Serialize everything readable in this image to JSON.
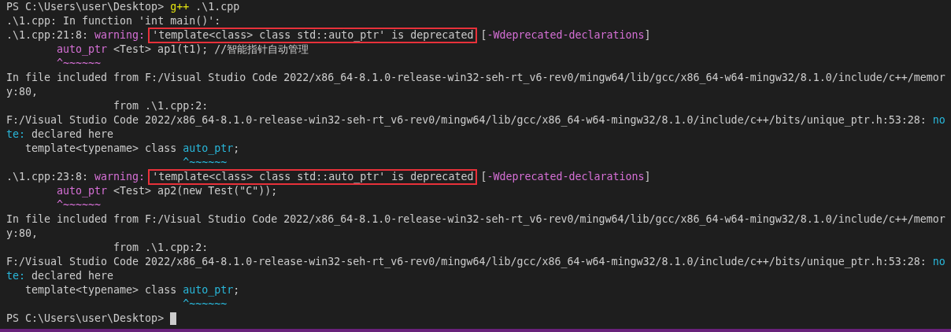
{
  "terminal": {
    "lines": [
      {
        "kind": "flush",
        "segments": [
          {
            "kind": "plain",
            "text": "PS C:\\Users\\user\\Desktop> "
          },
          {
            "kind": "command",
            "text": "g++"
          },
          {
            "kind": "plain",
            "text": " .\\1.cpp"
          }
        ]
      },
      {
        "kind": "flush",
        "segments": [
          {
            "kind": "plain",
            "text": ".\\1.cpp: In function 'int main()':"
          }
        ]
      },
      {
        "kind": "flush",
        "segments": [
          {
            "kind": "plain",
            "text": ".\\1.cpp:21:8: "
          },
          {
            "kind": "warning",
            "text": "warning:"
          },
          {
            "kind": "highlight",
            "text": "'template<class> class std::auto_ptr' is deprecated"
          },
          {
            "kind": "plain",
            "text": "["
          },
          {
            "kind": "warning",
            "text": "-Wdeprecated-declarations"
          },
          {
            "kind": "plain",
            "text": "]"
          }
        ]
      },
      {
        "kind": "source",
        "segments": [
          {
            "kind": "warning",
            "text": "auto_ptr"
          },
          {
            "kind": "plain",
            "text": " <Test> ap1(t1); //智能指针自动管理"
          }
        ]
      },
      {
        "kind": "source",
        "segments": [
          {
            "kind": "warning",
            "text": "^~~~~~~"
          }
        ]
      },
      {
        "kind": "flush",
        "segments": [
          {
            "kind": "plain",
            "text": "In file included from F:/Visual Studio Code 2022/x86_64-8.1.0-release-win32-seh-rt_v6-rev0/mingw64/lib/gcc/x86_64-w64-mingw32/8.1.0/include/c++/memor"
          }
        ]
      },
      {
        "kind": "flush",
        "segments": [
          {
            "kind": "plain",
            "text": "y:80,"
          }
        ]
      },
      {
        "kind": "include",
        "segments": [
          {
            "kind": "plain",
            "text": "from .\\1.cpp:2:"
          }
        ]
      },
      {
        "kind": "flush",
        "segments": [
          {
            "kind": "plain",
            "text": "F:/Visual Studio Code 2022/x86_64-8.1.0-release-win32-seh-rt_v6-rev0/mingw64/lib/gcc/x86_64-w64-mingw32/8.1.0/include/c++/bits/unique_ptr.h:53:28: "
          },
          {
            "kind": "note",
            "text": "no"
          }
        ]
      },
      {
        "kind": "flush",
        "segments": [
          {
            "kind": "note",
            "text": "te:"
          },
          {
            "kind": "plain",
            "text": " declared here"
          }
        ]
      },
      {
        "kind": "declaration",
        "segments": [
          {
            "kind": "plain",
            "text": "template<typename> class "
          },
          {
            "kind": "note",
            "text": "auto_ptr"
          },
          {
            "kind": "plain",
            "text": ";"
          }
        ]
      },
      {
        "kind": "marker",
        "segments": [
          {
            "kind": "note",
            "text": "^~~~~~~"
          }
        ]
      },
      {
        "kind": "flush",
        "segments": [
          {
            "kind": "plain",
            "text": ".\\1.cpp:23:8: "
          },
          {
            "kind": "warning",
            "text": "warning:"
          },
          {
            "kind": "highlight",
            "text": "'template<class> class std::auto_ptr' is deprecated"
          },
          {
            "kind": "plain",
            "text": "["
          },
          {
            "kind": "warning",
            "text": "-Wdeprecated-declarations"
          },
          {
            "kind": "plain",
            "text": "]"
          }
        ]
      },
      {
        "kind": "source",
        "segments": [
          {
            "kind": "warning",
            "text": "auto_ptr"
          },
          {
            "kind": "plain",
            "text": " <Test> ap2(new Test(\"C\"));"
          }
        ]
      },
      {
        "kind": "source",
        "segments": [
          {
            "kind": "warning",
            "text": "^~~~~~~"
          }
        ]
      },
      {
        "kind": "flush",
        "segments": [
          {
            "kind": "plain",
            "text": "In file included from F:/Visual Studio Code 2022/x86_64-8.1.0-release-win32-seh-rt_v6-rev0/mingw64/lib/gcc/x86_64-w64-mingw32/8.1.0/include/c++/memor"
          }
        ]
      },
      {
        "kind": "flush",
        "segments": [
          {
            "kind": "plain",
            "text": "y:80,"
          }
        ]
      },
      {
        "kind": "include",
        "segments": [
          {
            "kind": "plain",
            "text": "from .\\1.cpp:2:"
          }
        ]
      },
      {
        "kind": "flush",
        "segments": [
          {
            "kind": "plain",
            "text": "F:/Visual Studio Code 2022/x86_64-8.1.0-release-win32-seh-rt_v6-rev0/mingw64/lib/gcc/x86_64-w64-mingw32/8.1.0/include/c++/bits/unique_ptr.h:53:28: "
          },
          {
            "kind": "note",
            "text": "no"
          }
        ]
      },
      {
        "kind": "flush",
        "segments": [
          {
            "kind": "note",
            "text": "te:"
          },
          {
            "kind": "plain",
            "text": " declared here"
          }
        ]
      },
      {
        "kind": "declaration",
        "segments": [
          {
            "kind": "plain",
            "text": "template<typename> class "
          },
          {
            "kind": "note",
            "text": "auto_ptr"
          },
          {
            "kind": "plain",
            "text": ";"
          }
        ]
      },
      {
        "kind": "marker",
        "segments": [
          {
            "kind": "note",
            "text": "^~~~~~~"
          }
        ]
      },
      {
        "kind": "flush",
        "segments": [
          {
            "kind": "plain",
            "text": "PS C:\\Users\\user\\Desktop> "
          }
        ],
        "cursor": true
      }
    ]
  }
}
